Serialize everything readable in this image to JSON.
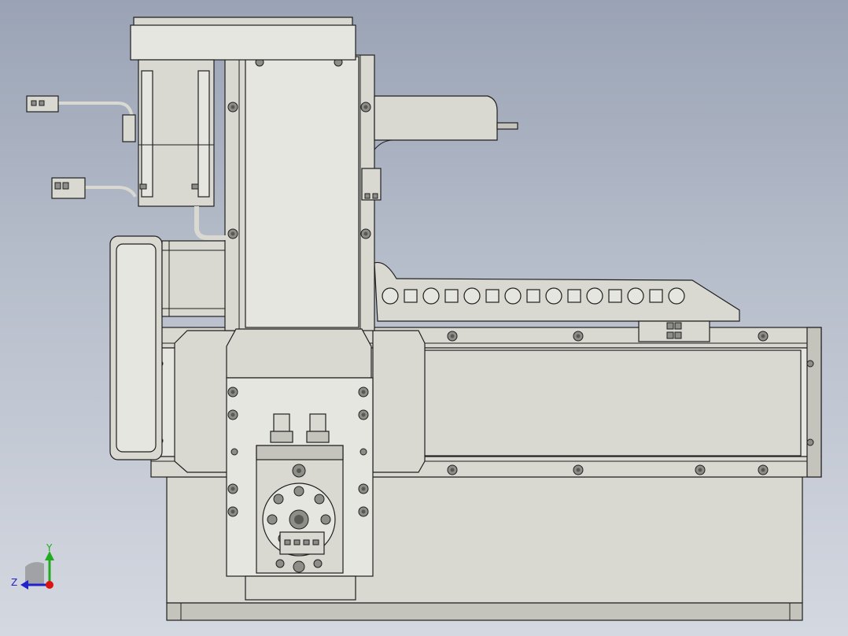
{
  "triad": {
    "y_label": "Y",
    "z_label": "Z",
    "y_color": "#22aa22",
    "z_color": "#2222cc",
    "x_color": "#dd1111"
  },
  "colors": {
    "background_top": "#9aa3b5",
    "background_bottom": "#d4d8e0",
    "part_fill": "#d9d9d2",
    "edge": "#1f1f1f"
  }
}
